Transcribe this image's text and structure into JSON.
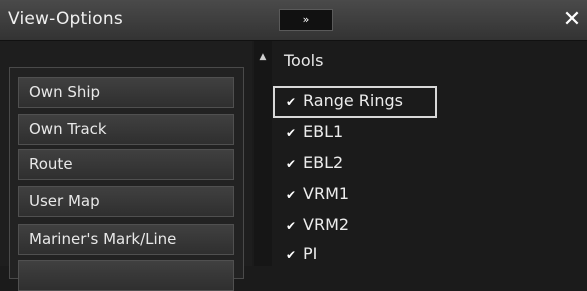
{
  "window": {
    "title": "View-Options",
    "expand_label": "»",
    "close_label": "✕"
  },
  "menu": {
    "items": [
      {
        "label": "Own Ship"
      },
      {
        "label": "Own Track"
      },
      {
        "label": "Route"
      },
      {
        "label": "User Map"
      },
      {
        "label": "Mariner's Mark/Line"
      }
    ]
  },
  "scroll": {
    "up_label": "▲"
  },
  "tools": {
    "title": "Tools",
    "items": [
      {
        "label": "Range Rings",
        "checked": true,
        "check": "✔"
      },
      {
        "label": "EBL1",
        "checked": true,
        "check": "✔"
      },
      {
        "label": "EBL2",
        "checked": true,
        "check": "✔"
      },
      {
        "label": "VRM1",
        "checked": true,
        "check": "✔"
      },
      {
        "label": "VRM2",
        "checked": true,
        "check": "✔"
      },
      {
        "label": "PI",
        "checked": true,
        "check": "✔"
      }
    ]
  }
}
